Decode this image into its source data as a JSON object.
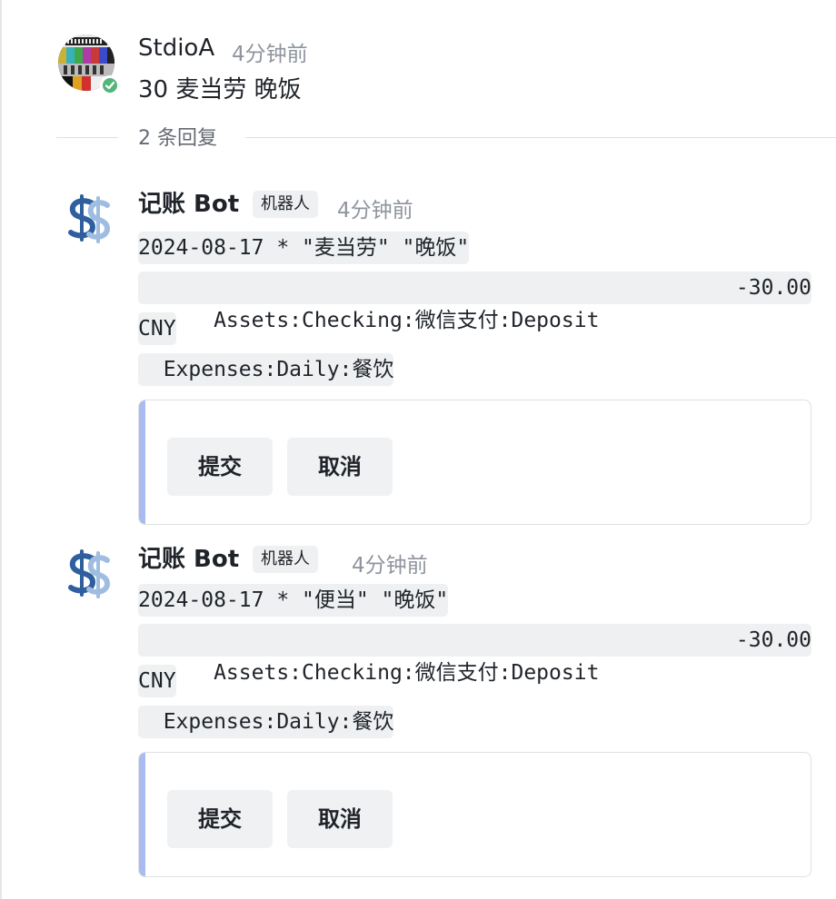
{
  "thread": {
    "author": "StdioA",
    "time": "4分钟前",
    "text": "30 麦当劳 晚饭",
    "reply_count": "2 条回复"
  },
  "replies": [
    {
      "author": "记账 Bot",
      "badge": "机器人",
      "time": "4分钟前",
      "line1": "2024-08-17 * \"麦当劳\" \"晚饭\"",
      "line2_account": "  Assets:Checking:微信支付:Deposit",
      "line2_amount": "-30.00",
      "line3": "CNY",
      "line4": "  Expenses:Daily:餐饮",
      "submit_label": "提交",
      "cancel_label": "取消"
    },
    {
      "author": "记账 Bot",
      "badge": "机器人",
      "time": "4分钟前",
      "line1": "2024-08-17 * \"便当\" \"晚饭\"",
      "line2_account": "  Assets:Checking:微信支付:Deposit",
      "line2_amount": "-30.00",
      "line3": "CNY",
      "line4": "  Expenses:Daily:餐饮",
      "submit_label": "提交",
      "cancel_label": "取消"
    }
  ],
  "colors": {
    "online_status": "#52b57a",
    "card_accent": "#a9bbf0",
    "bot_icon_dark": "#2f5f9e",
    "bot_icon_light": "#9fbde0"
  },
  "icons": {
    "main_avatar": "test-pattern-avatar",
    "status": "check-circle-icon",
    "bot_avatar": "dollar-icon"
  }
}
